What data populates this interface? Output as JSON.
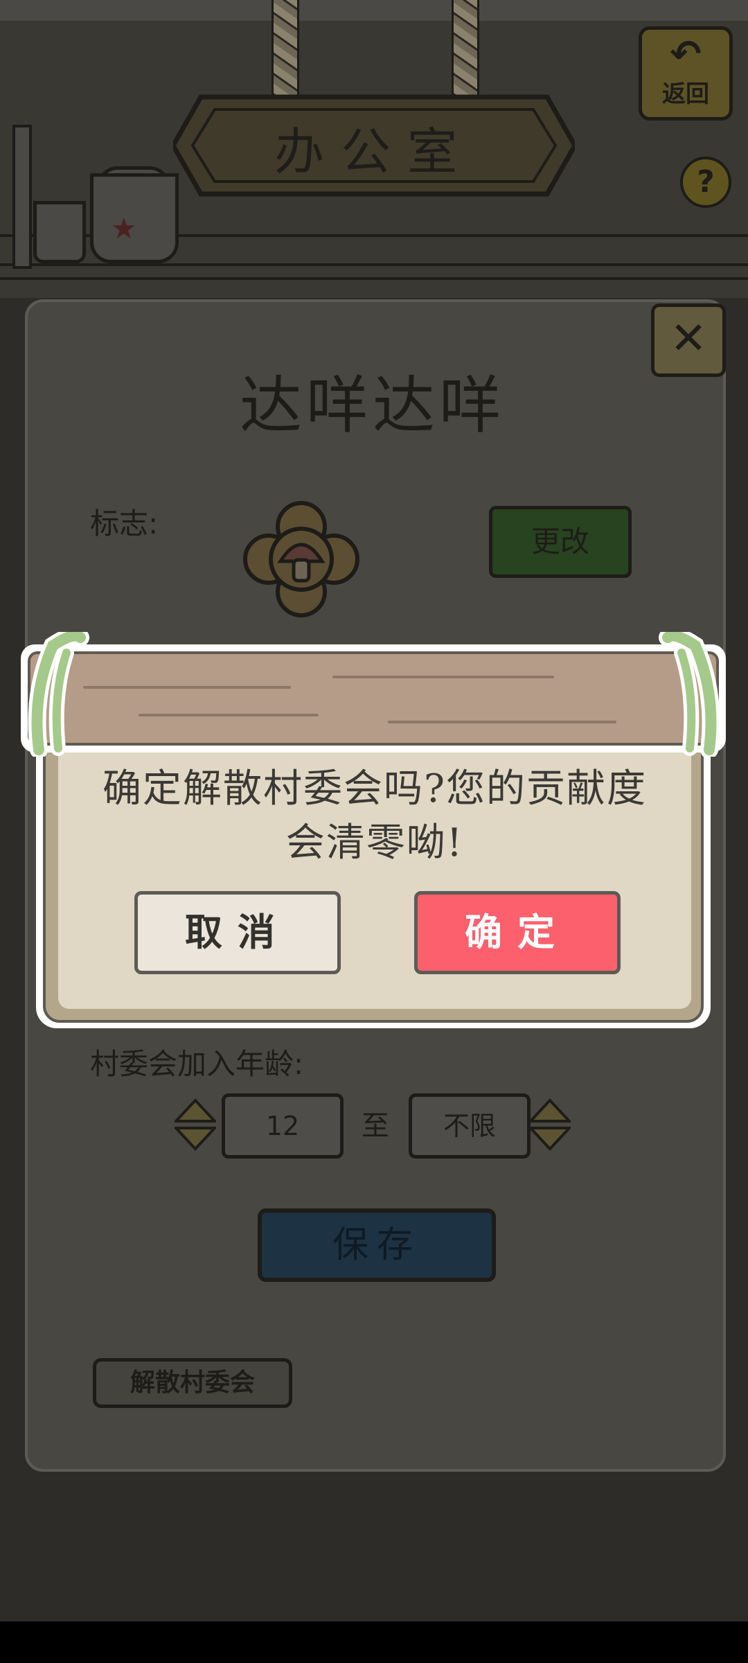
{
  "header": {
    "room_title": "办公室",
    "back_label": "返回",
    "help_symbol": "?"
  },
  "panel": {
    "close_symbol": "✕",
    "title": "达咩达咩",
    "emblem_label": "标志:",
    "emblem_icon": "mushroom-icon",
    "change_button": "更改",
    "age_label": "村委会加入年龄:",
    "age_min": "12",
    "age_separator": "至",
    "age_max": "不限",
    "save_button": "保存",
    "disband_button": "解散村委会"
  },
  "dialog": {
    "message_line1": "确定解散村委会吗?您的贡献度",
    "message_line2": "会清零呦!",
    "cancel_button": "取消",
    "confirm_button": "确定"
  },
  "colors": {
    "confirm": "#fb606c",
    "cancel": "#ebe5db",
    "dialog_bg": "#e0d8c4",
    "board": "#b59c88",
    "vine": "#a5c98a"
  }
}
